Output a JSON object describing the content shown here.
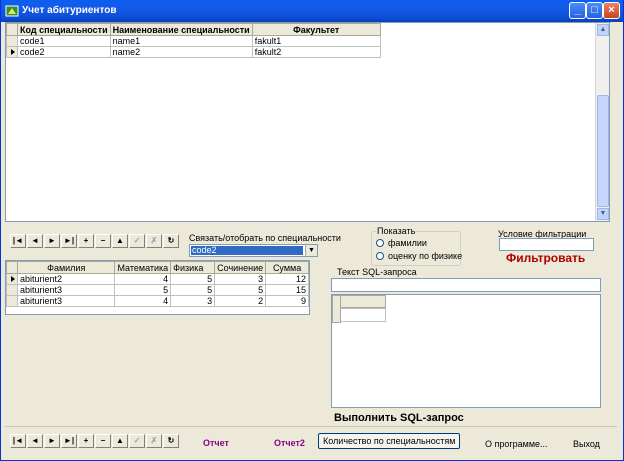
{
  "window": {
    "title": "Учет абитуриентов",
    "controls": {
      "minimize": "_",
      "maximize": "□",
      "close": "×"
    }
  },
  "top_grid": {
    "columns": [
      "Код специальности",
      "Наименование специальности",
      "Факультет"
    ],
    "rows": [
      {
        "current": false,
        "cells": [
          "code1",
          "name1",
          "fakult1"
        ]
      },
      {
        "current": true,
        "cells": [
          "code2",
          "name2",
          "fakult2"
        ]
      }
    ]
  },
  "navigator": {
    "buttons": [
      "|◄",
      "◄",
      "►",
      "►|",
      "+",
      "−",
      "▲",
      "✓",
      "✗",
      "↻"
    ]
  },
  "specialty_filter": {
    "label": "Связать/отобрать по специальности",
    "selected": "code2"
  },
  "show_group": {
    "title": "Показать",
    "options": [
      "фамилии",
      "оценку по физике"
    ]
  },
  "filter_condition": {
    "label": "Условие фильтрации",
    "value": "",
    "button": "Фильтровать"
  },
  "bottom_grid": {
    "columns": [
      "Фамилия",
      "Математика",
      "Физика",
      "Сочинение",
      "Сумма"
    ],
    "rows": [
      {
        "current": true,
        "cells": [
          "abiturient2",
          "4",
          "5",
          "3",
          "12"
        ]
      },
      {
        "current": false,
        "cells": [
          "abiturient3",
          "5",
          "5",
          "5",
          "15"
        ]
      },
      {
        "current": false,
        "cells": [
          "abiturient3",
          "4",
          "3",
          "2",
          "9"
        ]
      }
    ]
  },
  "sql": {
    "label": "Текст SQL-запроса",
    "value": "",
    "execute_button": "Выполнить SQL-запрос"
  },
  "bottom_bar": {
    "report1": "Отчет",
    "report2": "Отчет2",
    "count_button": "Количество по специальностям",
    "about": "О программе...",
    "exit": "Выход"
  },
  "colors": {
    "title_bar": "#0b4fd6",
    "selection": "#316ac5",
    "filter_text": "#b00000",
    "link_text": "#8b008b"
  },
  "icons": [
    "app-icon",
    "minimize-icon",
    "maximize-icon",
    "close-icon",
    "row-indicator-icon",
    "dropdown-arrow-icon"
  ]
}
